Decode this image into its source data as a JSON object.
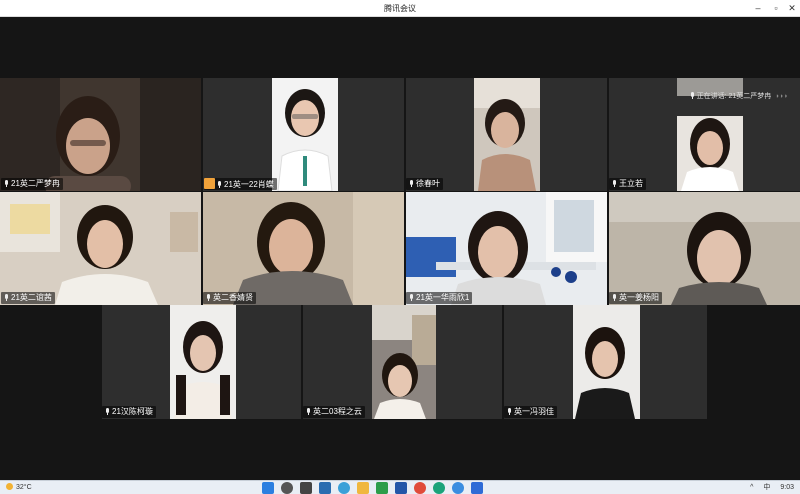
{
  "window": {
    "title": "腾讯会议"
  },
  "speaking_indicator": {
    "label": "正在讲话: 21英二严梦冉"
  },
  "participants": [
    {
      "name": "21英二严梦冉"
    },
    {
      "name": "21英一22肖蝶",
      "host": true
    },
    {
      "name": "徐春叶"
    },
    {
      "name": "王立若"
    },
    {
      "name": "21英二谊茜"
    },
    {
      "name": "英二香婧贤"
    },
    {
      "name": "21英一华雨欣1"
    },
    {
      "name": "英一姜杨阳"
    },
    {
      "name": "21汉陈柯璇"
    },
    {
      "name": "英二03程之云"
    },
    {
      "name": "英一冯羽佳"
    }
  ],
  "taskbar": {
    "weather": "32°C",
    "clock": "9:03",
    "tray_text": "中"
  },
  "colors": {
    "tile_bg": "#2e2e2e",
    "stage_bg": "#151515",
    "host_badge": "#f0a23a"
  }
}
